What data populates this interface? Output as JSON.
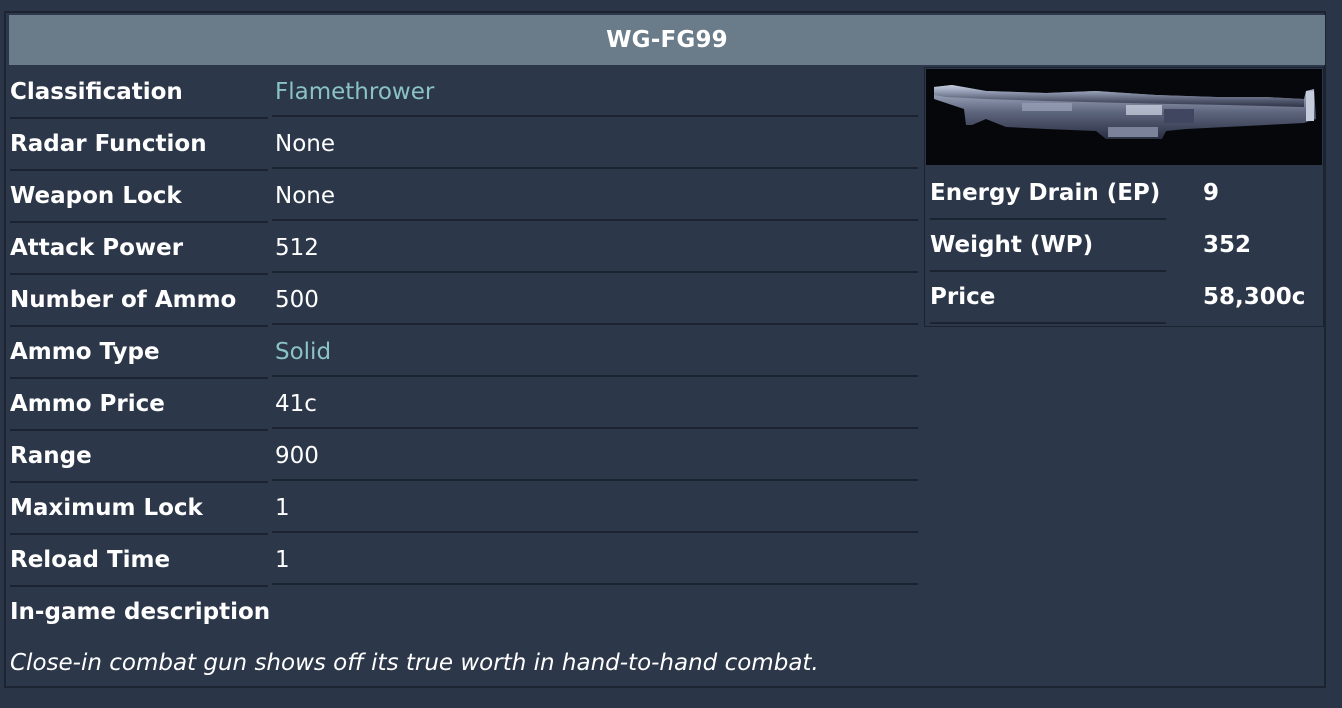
{
  "title": "WG-FG99",
  "specs": [
    {
      "label": "Classification",
      "value": "Flamethrower",
      "link": true
    },
    {
      "label": "Radar Function",
      "value": "None",
      "link": false
    },
    {
      "label": "Weapon Lock",
      "value": "None",
      "link": false
    },
    {
      "label": "Attack Power",
      "value": "512",
      "link": false
    },
    {
      "label": "Number of Ammo",
      "value": "500",
      "link": false
    },
    {
      "label": "Ammo Type",
      "value": "Solid",
      "link": true
    },
    {
      "label": "Ammo Price",
      "value": "41c",
      "link": false
    },
    {
      "label": "Range",
      "value": "900",
      "link": false
    },
    {
      "label": "Maximum Lock",
      "value": "1",
      "link": false
    },
    {
      "label": "Reload Time",
      "value": "1",
      "link": false
    }
  ],
  "description": {
    "header": "In-game description",
    "text": "Close-in combat gun shows off its true worth in hand-to-hand combat."
  },
  "stats": [
    {
      "label": "Energy Drain (EP)",
      "value": "9"
    },
    {
      "label": "Weight (WP)",
      "value": "352"
    },
    {
      "label": "Price",
      "value": "58,300c"
    }
  ],
  "image": {
    "icon": "flamethrower-weapon-image"
  },
  "colors": {
    "background": "#2b3548",
    "title_bar": "#6a7b89",
    "link": "#8ac3c4",
    "image_background": "#06070b"
  }
}
